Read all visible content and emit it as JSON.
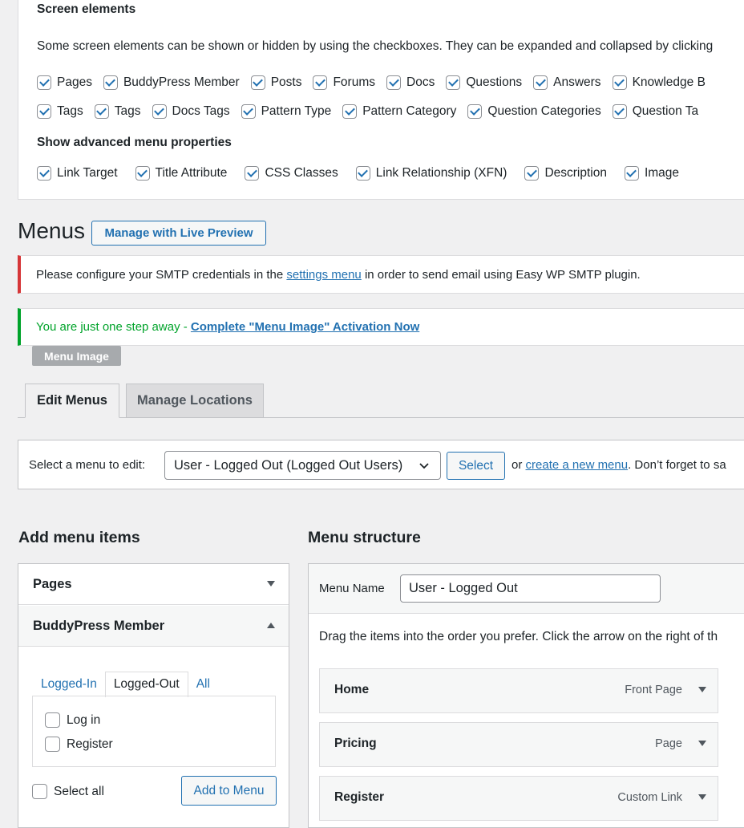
{
  "screen_options": {
    "title": "Screen elements",
    "description": "Some screen elements can be shown or hidden by using the checkboxes. They can be expanded and collapsed by clicking",
    "row1": [
      "Pages",
      "BuddyPress Member",
      "Posts",
      "Forums",
      "Docs",
      "Questions",
      "Answers",
      "Knowledge B"
    ],
    "row2": [
      "Tags",
      "Tags",
      "Docs Tags",
      "Pattern Type",
      "Pattern Category",
      "Question Categories",
      "Question Ta"
    ],
    "advanced_title": "Show advanced menu properties",
    "advanced": [
      "Link Target",
      "Title Attribute",
      "CSS Classes",
      "Link Relationship (XFN)",
      "Description",
      "Image"
    ]
  },
  "page": {
    "title": "Menus",
    "live_preview_button": "Manage with Live Preview"
  },
  "notices": {
    "smtp_before": "Please configure your SMTP credentials in the ",
    "smtp_link": "settings menu",
    "smtp_after": " in order to send email using Easy WP SMTP plugin.",
    "activation_text": "You are just one step away - ",
    "activation_link": "Complete \"Menu Image\" Activation Now",
    "badge": "Menu Image"
  },
  "tabs": {
    "edit": "Edit Menus",
    "locations": "Manage Locations"
  },
  "select_bar": {
    "label": "Select a menu to edit:",
    "selected": "User - Logged Out (Logged Out Users)",
    "button": "Select",
    "or_text": "or ",
    "create_link": "create a new menu",
    "after_text": ". Don’t forget to sa"
  },
  "add_items": {
    "title": "Add menu items",
    "pages_header": "Pages",
    "bp_header": "BuddyPress Member",
    "bp_tabs": [
      "Logged-In",
      "Logged-Out",
      "All"
    ],
    "bp_items": [
      "Log in",
      "Register"
    ],
    "select_all": "Select all",
    "add_button": "Add to Menu"
  },
  "menu_structure": {
    "title": "Menu structure",
    "name_label": "Menu Name",
    "name_value": "User - Logged Out",
    "help": "Drag the items into the order you prefer. Click the arrow on the right of th",
    "items": [
      {
        "title": "Home",
        "type": "Front Page"
      },
      {
        "title": "Pricing",
        "type": "Page"
      },
      {
        "title": "Register",
        "type": "Custom Link"
      }
    ]
  },
  "colors": {
    "accent": "#2271b1",
    "error": "#d63638",
    "success": "#00a32a"
  }
}
